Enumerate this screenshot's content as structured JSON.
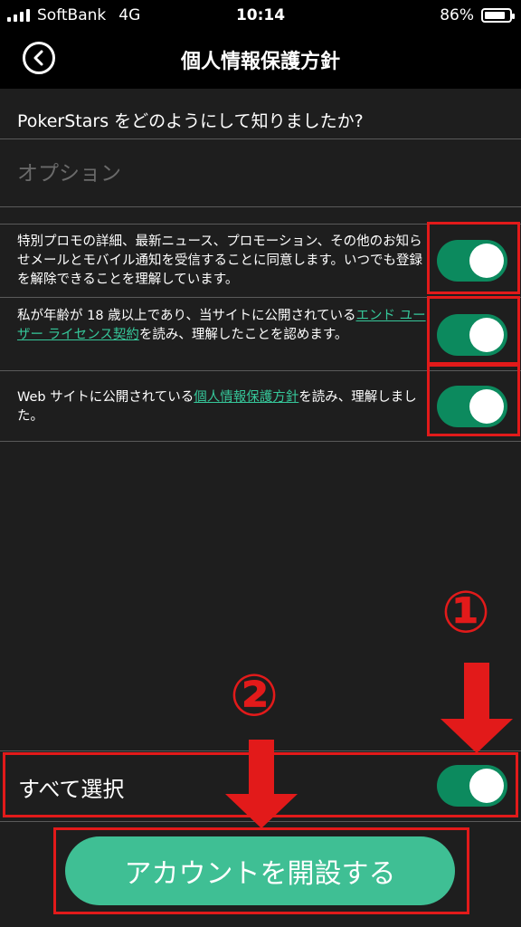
{
  "status_bar": {
    "carrier": "SoftBank",
    "network": "4G",
    "time": "10:14",
    "battery": "86%",
    "battery_level": 0.86
  },
  "nav": {
    "title": "個人情報保護方針",
    "back_icon": "chevron-left-icon"
  },
  "form": {
    "question": "PokerStars をどのようにして知りましたか?",
    "option_placeholder": "オプション",
    "option_value": ""
  },
  "consents": [
    {
      "text": "特別プロモの詳細、最新ニュース、プロモーション、その他のお知らせメールとモバイル通知を受信することに同意します。いつでも登録を解除できることを理解しています。",
      "checked": true
    },
    {
      "text_before": "私が年齢が 18 歳以上であり、当サイトに公開されている",
      "link": "エンド ユーザー ライセンス契約",
      "text_after": "を読み、理解したことを認めます。",
      "checked": true
    },
    {
      "text_before": "Web サイトに公開されている",
      "link": "個人情報保護方針",
      "text_after": "を読み、理解しました。",
      "checked": true
    }
  ],
  "select_all": {
    "label": "すべて選択",
    "checked": true
  },
  "cta": {
    "label": "アカウントを開設する"
  },
  "annotations": {
    "marker_1": "①",
    "marker_2": "②"
  },
  "colors": {
    "background": "#1e1e1e",
    "toggle_on": "#0c8a5e",
    "link": "#36c79a",
    "cta": "#3fbf94",
    "annotation_red": "#e21a1a"
  }
}
